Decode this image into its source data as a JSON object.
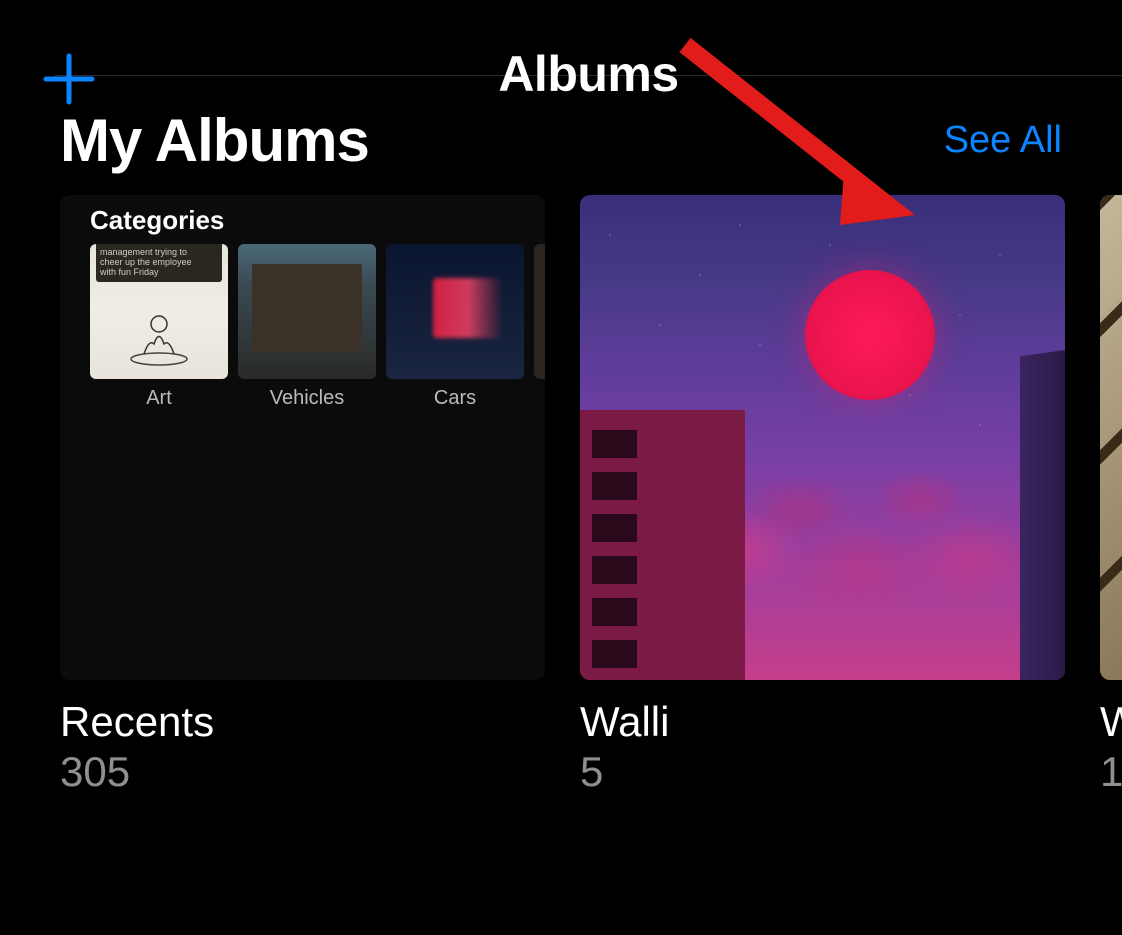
{
  "header": {
    "title": "Albums"
  },
  "section": {
    "title": "My Albums",
    "seeAll": "See All"
  },
  "albums": [
    {
      "title": "Recents",
      "count": "305",
      "cover": {
        "type": "categories",
        "label": "Categories",
        "items": [
          {
            "label": "Art"
          },
          {
            "label": "Vehicles"
          },
          {
            "label": "Cars"
          }
        ]
      }
    },
    {
      "title": "Walli",
      "count": "5",
      "cover": {
        "type": "vaporwave"
      }
    },
    {
      "title": "W",
      "count": "1",
      "cover": {
        "type": "partial"
      }
    }
  ],
  "annotation": {
    "type": "arrow",
    "target": "see-all-link"
  }
}
